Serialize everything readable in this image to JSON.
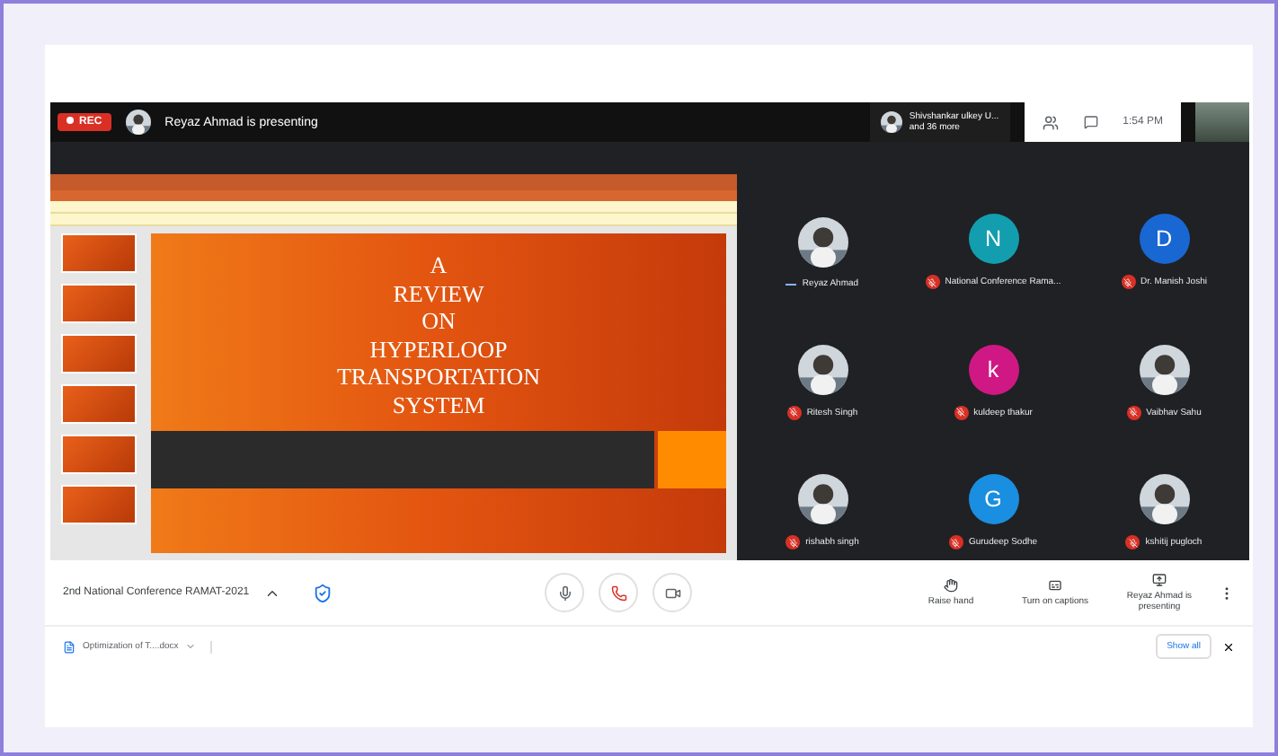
{
  "top_bar": {
    "rec": "REC",
    "presenter": "Reyaz Ahmad is presenting",
    "attendees": {
      "name": "Shivshankar ulkey U...",
      "more": "and 36 more"
    },
    "time": "1:54 PM"
  },
  "slide": {
    "lines": [
      "A",
      "REVIEW",
      "ON",
      "HYPERLOOP",
      "TRANSPORTATION",
      "SYSTEM"
    ]
  },
  "participants": [
    {
      "name": "Reyaz Ahmad",
      "muted": false
    },
    {
      "name": "National Conference Rama...",
      "kind": "letter",
      "letter": "N",
      "color": "#129eaf",
      "muted": true
    },
    {
      "name": "Dr. Manish Joshi",
      "kind": "letter",
      "letter": "D",
      "color": "#1967d2",
      "muted": true
    },
    {
      "name": "Ritesh Singh",
      "muted": true
    },
    {
      "name": "kuldeep thakur",
      "kind": "letter",
      "letter": "k",
      "color": "#d01884",
      "muted": true
    },
    {
      "name": "Vaibhav Sahu",
      "muted": true
    },
    {
      "name": "rishabh singh",
      "muted": true
    },
    {
      "name": "Gurudeep Sodhe",
      "kind": "letter",
      "letter": "G",
      "color": "#1a8ee0",
      "muted": true
    },
    {
      "name": "kshitij pugloch",
      "muted": true
    }
  ],
  "bottom_bar": {
    "meeting": "2nd National Conference RAMAT-2021",
    "actions": [
      "Raise hand",
      "Turn on captions",
      "Reyaz Ahmad is presenting"
    ]
  },
  "downloads": {
    "file": "Optimization of T....docx",
    "show_all": "Show all"
  }
}
